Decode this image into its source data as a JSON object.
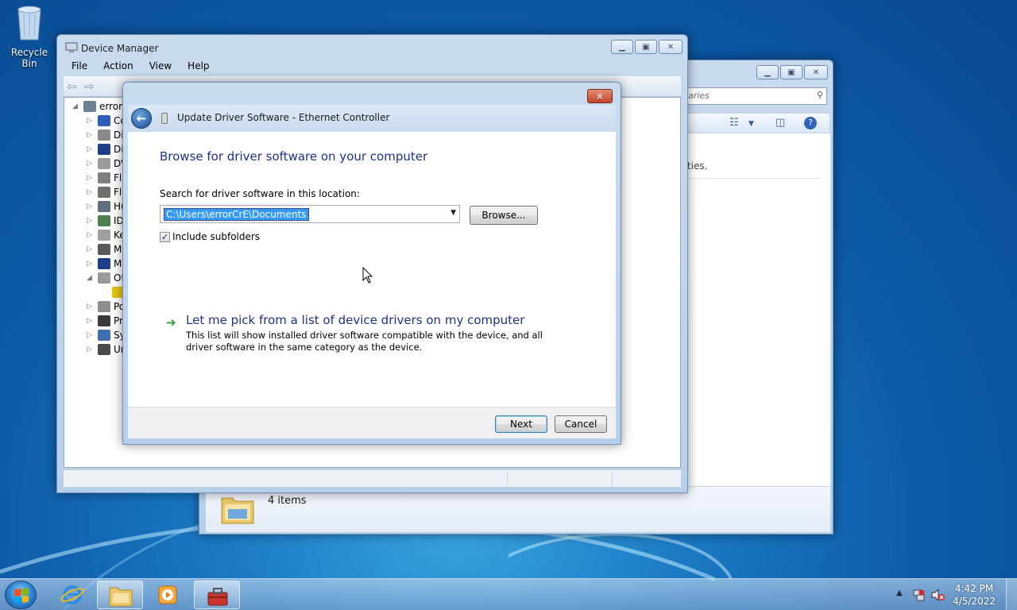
{
  "desktop": {
    "recycle_bin_label": "Recycle Bin"
  },
  "explorer": {
    "search_placeholder": "aries",
    "content_fragment": "ties.",
    "details_count": "4 items"
  },
  "device_manager": {
    "title": "Device Manager",
    "menu": [
      "File",
      "Action",
      "View",
      "Help"
    ],
    "tree": [
      {
        "label": "errorC",
        "expander": "◢",
        "indent": 0,
        "color": "#6d7f93"
      },
      {
        "label": "Co",
        "expander": "▷",
        "indent": 1,
        "color": "#2d5fb8"
      },
      {
        "label": "Di",
        "expander": "▷",
        "indent": 1,
        "color": "#8a8a8a"
      },
      {
        "label": "Di",
        "expander": "▷",
        "indent": 1,
        "color": "#1c3f8a"
      },
      {
        "label": "DV",
        "expander": "▷",
        "indent": 1,
        "color": "#9b9b9b"
      },
      {
        "label": "Fl",
        "expander": "▷",
        "indent": 1,
        "color": "#7f7f7f"
      },
      {
        "label": "Fl",
        "expander": "▷",
        "indent": 1,
        "color": "#6f6f6f"
      },
      {
        "label": "Hu",
        "expander": "▷",
        "indent": 1,
        "color": "#5f6f80"
      },
      {
        "label": "ID",
        "expander": "▷",
        "indent": 1,
        "color": "#4e7f4e"
      },
      {
        "label": "Ke",
        "expander": "▷",
        "indent": 1,
        "color": "#a0a0a0"
      },
      {
        "label": "M",
        "expander": "▷",
        "indent": 1,
        "color": "#5a5a5a"
      },
      {
        "label": "M",
        "expander": "▷",
        "indent": 1,
        "color": "#1c3f8a"
      },
      {
        "label": "Ot",
        "expander": "◢",
        "indent": 1,
        "color": "#9a9a9a"
      },
      {
        "label": "",
        "expander": "",
        "indent": 2,
        "color": "#e6c300"
      },
      {
        "label": "Po",
        "expander": "▷",
        "indent": 1,
        "color": "#8f8f8f"
      },
      {
        "label": "Pr",
        "expander": "▷",
        "indent": 1,
        "color": "#3a3a3a"
      },
      {
        "label": "Sy",
        "expander": "▷",
        "indent": 1,
        "color": "#3f6fb0"
      },
      {
        "label": "Ur",
        "expander": "▷",
        "indent": 1,
        "color": "#4a4a4a"
      }
    ]
  },
  "driver_dialog": {
    "title": "Update Driver Software - Ethernet Controller",
    "main_instruction": "Browse for driver software on your computer",
    "search_label": "Search for driver software in this location:",
    "location_value": "C:\\Users\\errorCrE\\Documents",
    "browse_label": "Browse...",
    "include_subfolders_label": "Include subfolders",
    "include_subfolders_checked": true,
    "pick_link_title": "Let me pick from a list of device drivers on my computer",
    "pick_link_desc": "This list will show installed driver software compatible with the device, and all driver software in the same category as the device.",
    "next_label": "Next",
    "cancel_label": "Cancel",
    "close_glyph": "✕"
  },
  "taskbar": {
    "time": "4:42 PM",
    "date": "4/5/2022",
    "buttons": [
      "explorer",
      "internet-explorer",
      "media-player",
      "device-manager"
    ]
  }
}
